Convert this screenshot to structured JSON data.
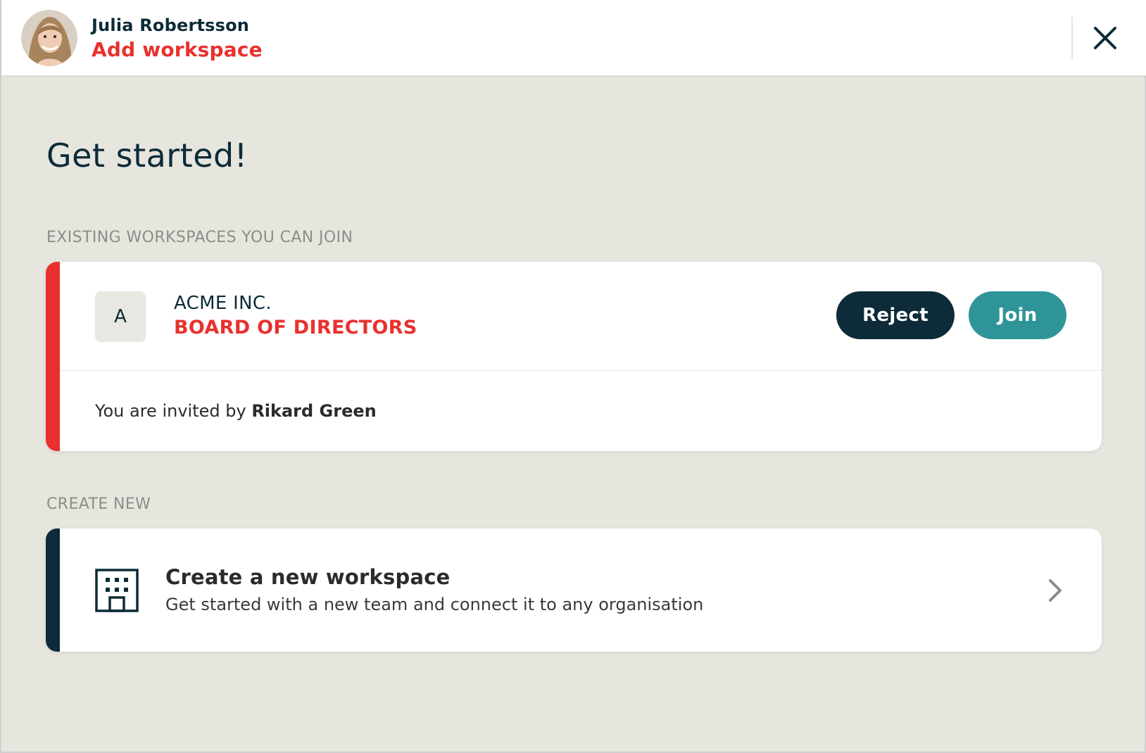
{
  "header": {
    "user_name": "Julia Robertsson",
    "subtitle": "Add workspace",
    "avatar_icon": "user-avatar-photo",
    "close_icon": "close-icon"
  },
  "main": {
    "title": "Get started!",
    "existing_section_label": "EXISTING WORKSPACES YOU CAN JOIN",
    "invite": {
      "badge_letter": "A",
      "organisation": "ACME INC.",
      "workspace_name": "BOARD OF DIRECTORS",
      "reject_label": "Reject",
      "join_label": "Join",
      "invited_by_prefix": "You are invited by",
      "invited_by_name": "Rikard Green"
    },
    "create_section_label": "CREATE NEW",
    "create": {
      "icon": "building-icon",
      "title": "Create a new workspace",
      "description": "Get started with a new team and connect it to any organisation",
      "chevron_icon": "chevron-right-icon"
    }
  },
  "colors": {
    "accent_red": "#e8312e",
    "dark_navy": "#0d2b38",
    "teal": "#2f9497",
    "background": "#e6e5de"
  }
}
